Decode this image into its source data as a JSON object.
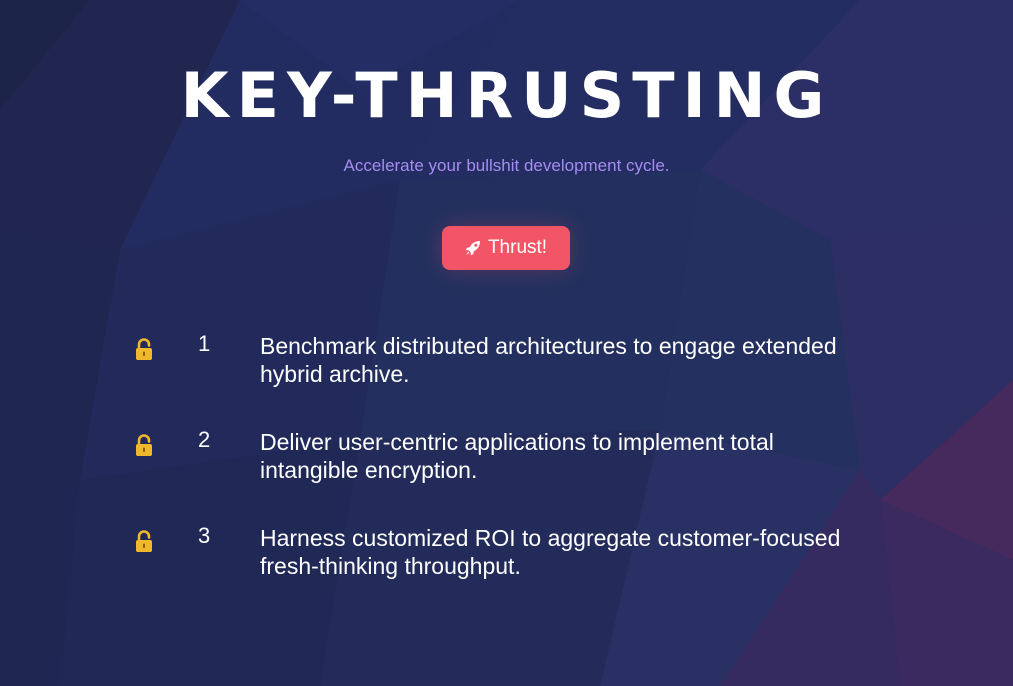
{
  "header": {
    "title": "KEY-THRUSTING",
    "subtitle": "Accelerate your bullshit development cycle."
  },
  "action": {
    "label": "Thrust!",
    "icon": "rocket-icon"
  },
  "items": [
    {
      "number": "1",
      "text": "Benchmark distributed architectures to engage extended hybrid archive.",
      "icon": "unlocked-padlock-icon"
    },
    {
      "number": "2",
      "text": "Deliver user-centric applications to implement total intangible encryption.",
      "icon": "unlocked-padlock-icon"
    },
    {
      "number": "3",
      "text": "Harness customized ROI to aggregate customer-focused fresh-thinking throughput.",
      "icon": "unlocked-padlock-icon"
    }
  ],
  "colors": {
    "background": "#22295a",
    "accent": "#f25566",
    "subtitle": "#a48cf0",
    "lock": "#f1b82c"
  }
}
